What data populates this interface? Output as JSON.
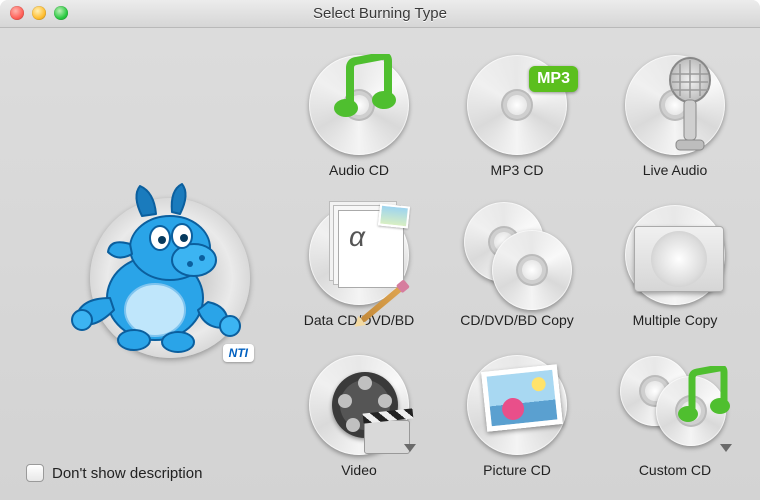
{
  "window": {
    "title": "Select Burning Type"
  },
  "mascot": {
    "brand": "NTI"
  },
  "checkbox": {
    "label": "Don't show description",
    "checked": false
  },
  "options": [
    {
      "id": "audio-cd",
      "label": "Audio CD",
      "has_dropdown": false
    },
    {
      "id": "mp3-cd",
      "label": "MP3 CD",
      "has_dropdown": false,
      "badge": "MP3"
    },
    {
      "id": "live-audio",
      "label": "Live Audio",
      "has_dropdown": false
    },
    {
      "id": "data-cd",
      "label": "Data CD/DVD/BD",
      "has_dropdown": false
    },
    {
      "id": "disc-copy",
      "label": "CD/DVD/BD Copy",
      "has_dropdown": false
    },
    {
      "id": "multi-copy",
      "label": "Multiple Copy",
      "has_dropdown": false
    },
    {
      "id": "video",
      "label": "Video",
      "has_dropdown": true
    },
    {
      "id": "picture-cd",
      "label": "Picture CD",
      "has_dropdown": false
    },
    {
      "id": "custom-cd",
      "label": "Custom CD",
      "has_dropdown": true
    }
  ]
}
